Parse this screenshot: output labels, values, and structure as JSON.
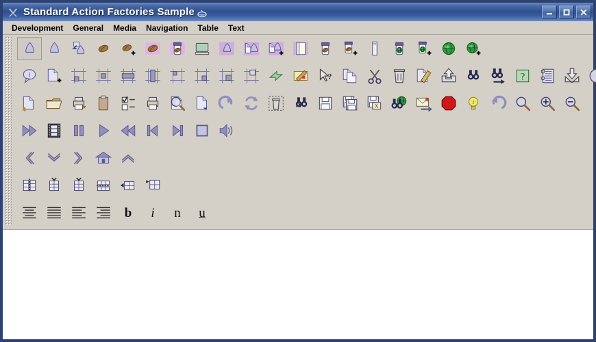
{
  "window": {
    "title": "Standard Action Factories Sample",
    "app_icon": "java-x-icon",
    "title_badge_icon": "coffee-cup-icon",
    "controls": [
      {
        "name": "minimize-button",
        "label": "–"
      },
      {
        "name": "maximize-button",
        "label": "□"
      },
      {
        "name": "close-button",
        "label": "✕"
      }
    ]
  },
  "menubar": {
    "items": [
      {
        "label": "Development"
      },
      {
        "label": "General"
      },
      {
        "label": "Media"
      },
      {
        "label": "Navigation"
      },
      {
        "label": "Table"
      },
      {
        "label": "Text"
      }
    ]
  },
  "colors": {
    "title_bar_start": "#6f8fc4",
    "title_bar_end": "#2f508f",
    "window_border": "#2c4372",
    "toolbar_bg": "#d4d0c8",
    "content_bg": "#ffffff",
    "icon_purple": "#8f8fc0",
    "icon_green": "#3f9f3f",
    "icon_red": "#cc0000",
    "icon_yellow": "#e8e04a"
  },
  "toolbars": [
    {
      "name": "development-toolbar",
      "icons": [
        {
          "name": "bean-shape-selected-icon",
          "tip": "Bean",
          "selected": true
        },
        {
          "name": "bean-shape-icon",
          "tip": "Bean"
        },
        {
          "name": "bean-import-icon",
          "tip": "Import Bean"
        },
        {
          "name": "coffee-bean-icon",
          "tip": "Class"
        },
        {
          "name": "coffee-bean-add-icon",
          "tip": "Add Class"
        },
        {
          "name": "coffee-bean-highlight-icon",
          "tip": "Class Highlight"
        },
        {
          "name": "jar-bean-highlight-icon",
          "tip": "Jar Bean"
        },
        {
          "name": "computer-icon",
          "tip": "Host"
        },
        {
          "name": "interface-shape-icon",
          "tip": "Interface"
        },
        {
          "name": "interface-doc-icon",
          "tip": "Interface Document"
        },
        {
          "name": "interface-doc-add-icon",
          "tip": "Add Interface"
        },
        {
          "name": "document-page-icon",
          "tip": "Document"
        },
        {
          "name": "jar-coffee-icon",
          "tip": "Jar"
        },
        {
          "name": "jar-coffee-add-icon",
          "tip": "Add Jar"
        },
        {
          "name": "library-bar-icon",
          "tip": "Library"
        },
        {
          "name": "jar-globe-icon",
          "tip": "Remote Jar"
        },
        {
          "name": "jar-globe-add-icon",
          "tip": "Add Remote Jar"
        },
        {
          "name": "globe-icon",
          "tip": "Server"
        },
        {
          "name": "globe-add-icon",
          "tip": "Add Server"
        }
      ]
    },
    {
      "name": "general-toolbar-row-1",
      "icons": [
        {
          "name": "about-info-icon",
          "tip": "About"
        },
        {
          "name": "new-file-add-icon",
          "tip": "Add"
        },
        {
          "name": "align-bottom-left-icon",
          "tip": "Align Bottom Left"
        },
        {
          "name": "align-center-box-icon",
          "tip": "Align Center"
        },
        {
          "name": "align-horizontal-icon",
          "tip": "Align Horizontal"
        },
        {
          "name": "align-vertical-icon",
          "tip": "Align Vertical"
        },
        {
          "name": "align-top-left-icon",
          "tip": "Align Top Left"
        },
        {
          "name": "align-bottom-right-icon",
          "tip": "Align Bottom Right"
        },
        {
          "name": "align-center-right-icon",
          "tip": "Align Right"
        },
        {
          "name": "align-top-right-icon",
          "tip": "Align Top Right"
        },
        {
          "name": "apply-arrow-icon",
          "tip": "Apply"
        },
        {
          "name": "compose-note-icon",
          "tip": "Compose"
        },
        {
          "name": "context-help-cursor-icon",
          "tip": "Context Help"
        },
        {
          "name": "copy-icon",
          "tip": "Copy"
        },
        {
          "name": "cut-scissors-icon",
          "tip": "Cut"
        },
        {
          "name": "delete-trash-icon",
          "tip": "Delete"
        },
        {
          "name": "edit-pencil-icon",
          "tip": "Edit"
        },
        {
          "name": "export-upload-icon",
          "tip": "Export"
        },
        {
          "name": "find-binoculars-icon",
          "tip": "Find"
        },
        {
          "name": "find-next-icon",
          "tip": "Find Next"
        },
        {
          "name": "help-question-icon",
          "tip": "Help"
        },
        {
          "name": "history-list-icon",
          "tip": "History"
        },
        {
          "name": "import-download-icon",
          "tip": "Import"
        },
        {
          "name": "information-icon",
          "tip": "Information"
        }
      ]
    },
    {
      "name": "general-toolbar-row-2",
      "icons": [
        {
          "name": "new-document-icon",
          "tip": "New"
        },
        {
          "name": "open-folder-icon",
          "tip": "Open"
        },
        {
          "name": "print-icon",
          "tip": "Print"
        },
        {
          "name": "paste-clipboard-icon",
          "tip": "Paste"
        },
        {
          "name": "properties-checklist-icon",
          "tip": "Properties"
        },
        {
          "name": "print-setup-icon",
          "tip": "Print Setup"
        },
        {
          "name": "print-preview-icon",
          "tip": "Print Preview"
        },
        {
          "name": "new-page-corner-icon",
          "tip": "Redo Page"
        },
        {
          "name": "redo-arrow-icon",
          "tip": "Redo"
        },
        {
          "name": "refresh-arrows-icon",
          "tip": "Refresh"
        },
        {
          "name": "remove-trash-dashed-icon",
          "tip": "Remove"
        },
        {
          "name": "replace-binoculars-icon",
          "tip": "Replace"
        },
        {
          "name": "save-floppy-icon",
          "tip": "Save"
        },
        {
          "name": "save-all-floppy-icon",
          "tip": "Save All"
        },
        {
          "name": "save-as-floppy-icon",
          "tip": "Save As"
        },
        {
          "name": "search-web-globe-icon",
          "tip": "Search Web"
        },
        {
          "name": "send-mail-icon",
          "tip": "Send"
        },
        {
          "name": "stop-octagon-icon",
          "tip": "Stop"
        },
        {
          "name": "tip-lightbulb-icon",
          "tip": "Tip of the Day"
        },
        {
          "name": "undo-arrow-icon",
          "tip": "Undo"
        },
        {
          "name": "zoom-magnifier-icon",
          "tip": "Zoom"
        },
        {
          "name": "zoom-in-icon",
          "tip": "Zoom In"
        },
        {
          "name": "zoom-out-icon",
          "tip": "Zoom Out"
        }
      ]
    },
    {
      "name": "media-toolbar",
      "icons": [
        {
          "name": "fast-forward-icon",
          "tip": "Fast Forward"
        },
        {
          "name": "movie-film-icon",
          "tip": "Movie"
        },
        {
          "name": "pause-icon",
          "tip": "Pause"
        },
        {
          "name": "play-icon",
          "tip": "Play"
        },
        {
          "name": "rewind-icon",
          "tip": "Rewind"
        },
        {
          "name": "step-back-icon",
          "tip": "Step Back"
        },
        {
          "name": "step-forward-icon",
          "tip": "Step Forward"
        },
        {
          "name": "stop-square-icon",
          "tip": "Stop"
        },
        {
          "name": "volume-speaker-icon",
          "tip": "Volume"
        }
      ]
    },
    {
      "name": "navigation-toolbar",
      "icons": [
        {
          "name": "back-chevron-icon",
          "tip": "Back"
        },
        {
          "name": "down-chevron-icon",
          "tip": "Down"
        },
        {
          "name": "forward-chevron-icon",
          "tip": "Forward"
        },
        {
          "name": "home-icon",
          "tip": "Home"
        },
        {
          "name": "up-chevron-icon",
          "tip": "Up"
        }
      ]
    },
    {
      "name": "table-toolbar",
      "icons": [
        {
          "name": "column-insert-icon",
          "tip": "Insert Column"
        },
        {
          "name": "column-delete-icon",
          "tip": "Delete Column"
        },
        {
          "name": "column-add-icon",
          "tip": "Add Column"
        },
        {
          "name": "row-insert-icon",
          "tip": "Insert Row"
        },
        {
          "name": "row-delete-icon",
          "tip": "Delete Row"
        },
        {
          "name": "row-add-icon",
          "tip": "Add Row"
        }
      ]
    },
    {
      "name": "text-toolbar",
      "icons": [
        {
          "name": "align-center-text-icon",
          "tip": "Align Center"
        },
        {
          "name": "align-justify-text-icon",
          "tip": "Justify"
        },
        {
          "name": "align-left-text-icon",
          "tip": "Align Left"
        },
        {
          "name": "align-right-text-icon",
          "tip": "Align Right"
        },
        {
          "name": "bold-icon",
          "tip": "Bold",
          "glyph": "b",
          "style": "b"
        },
        {
          "name": "italic-icon",
          "tip": "Italic",
          "glyph": "i",
          "style": "i"
        },
        {
          "name": "normal-icon",
          "tip": "Normal",
          "glyph": "n",
          "style": "n"
        },
        {
          "name": "underline-icon",
          "tip": "Underline",
          "glyph": "u",
          "style": "u"
        }
      ]
    }
  ]
}
